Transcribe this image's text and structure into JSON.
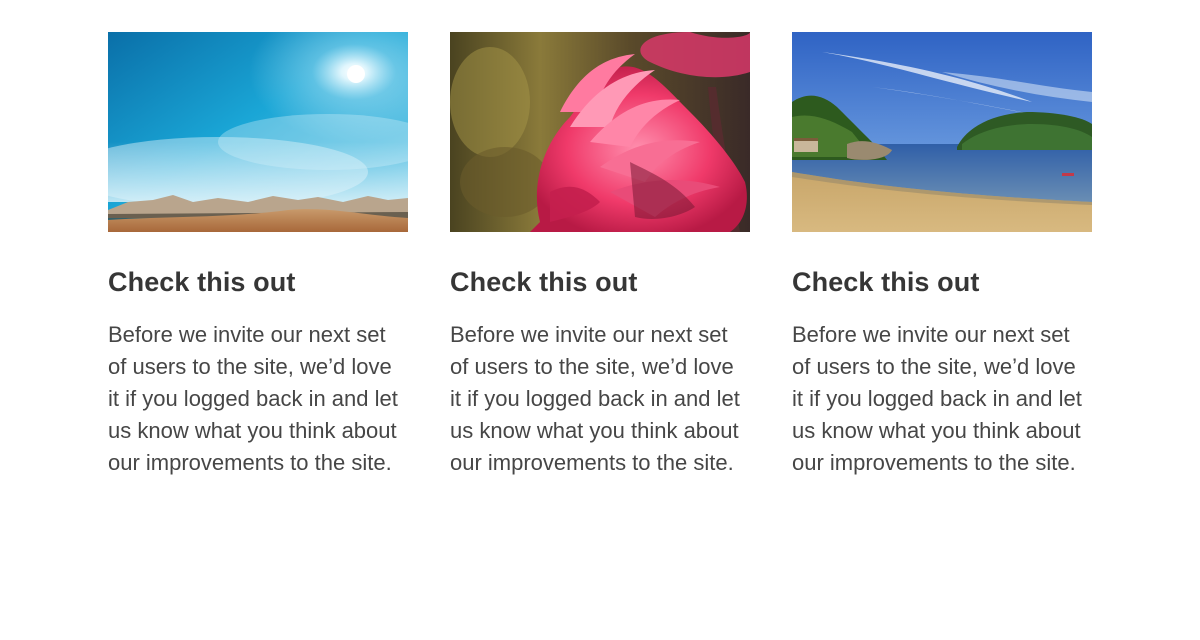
{
  "cards": [
    {
      "image": "desert-landscape-photo",
      "title": "Check this out",
      "body": "Before we invite our next set of users to the site, we’d love it if you logged back in and let us know what you think about our improvements to the site."
    },
    {
      "image": "pink-flamingo-photo",
      "title": "Check this out",
      "body": "Before we invite our next set of users to the site, we’d love it if you logged back in and let us know what you think about our improvements to the site."
    },
    {
      "image": "coastal-bay-photo",
      "title": "Check this out",
      "body": "Before we invite our next set of users to the site, we’d love it if you logged back in and let us know what you think about our improvements to the site."
    }
  ]
}
